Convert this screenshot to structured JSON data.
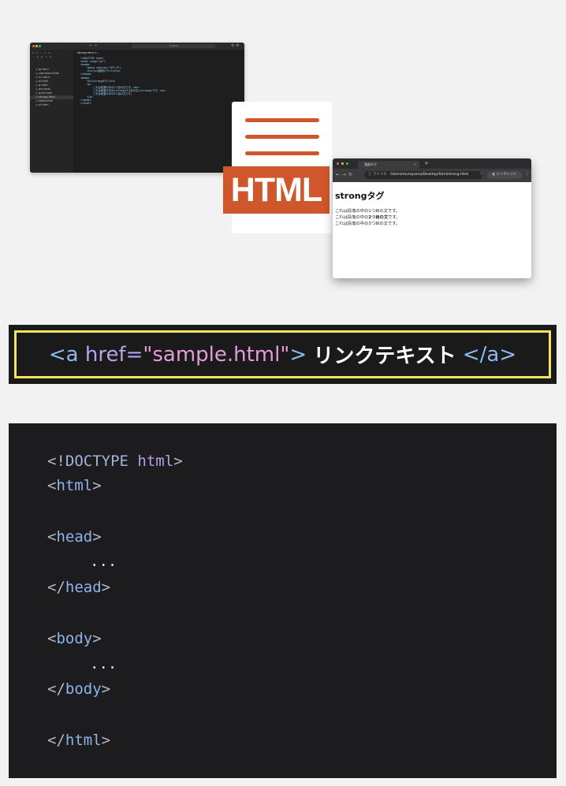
{
  "editor": {
    "search": "html",
    "tab": "strong.html",
    "tab_path": "strong.html >...",
    "files": [
      "br.html",
      "comment.html",
      "h1.html",
      "ol.html",
      "p.html",
      "pre.html",
      "pre2.html",
      "strong.html",
      "table.html",
      "ul.html"
    ],
    "active_file": "strong.html",
    "code_lines": [
      "<!DOCTYPE html>",
      "<html lang=\"ja\">",
      "",
      "<head>",
      "    <meta charset=\"UTF-8\">",
      "    <title>強調タグ</title>",
      "</head>",
      "",
      "<body>",
      "    <h1>strongタグ</h1>",
      "    <p>",
      "        これは段落の中の1つ目の文です。<br>",
      "        これは段落の中の<strong>2つ目の文</strong>です。<br>",
      "        これは段落の中の3つ目の文です。",
      "    </p>",
      "</body>",
      "",
      "</html>"
    ]
  },
  "file_icon": {
    "label": "HTML",
    "accent": "#d0572b"
  },
  "browser": {
    "tab_title": "強調タグ",
    "tab_close": "×",
    "new_tab": "+",
    "url_chip": "ファイル",
    "url": "/Users/murayama/Desktop/html/strong.html",
    "incognito": "シークレット",
    "heading": "strongタグ",
    "lines": [
      "これは段落の中の1つ目の文です。",
      "これは段落の中の",
      "2つ目の文",
      "です。",
      "これは段落の中の3つ目の文です。"
    ]
  },
  "anchor_example": {
    "open": "<a",
    "attr": "href=",
    "value": "\"sample.html\"",
    "close_bracket": ">",
    "text": "リンクテキスト",
    "closing_tag": "</a>",
    "border_color": "#f6e262"
  },
  "code_block": {
    "doctype_open": "<!",
    "doctype_kw": "DOCTYPE",
    "doctype_attr": "html",
    "doctype_close": ">",
    "html_open": "html",
    "head_open": "head",
    "ellipsis": "...",
    "head_close": "head",
    "body_open": "body",
    "body_close": "body",
    "html_close": "html",
    "lt": "<",
    "gt": ">",
    "lt_slash": "</"
  }
}
